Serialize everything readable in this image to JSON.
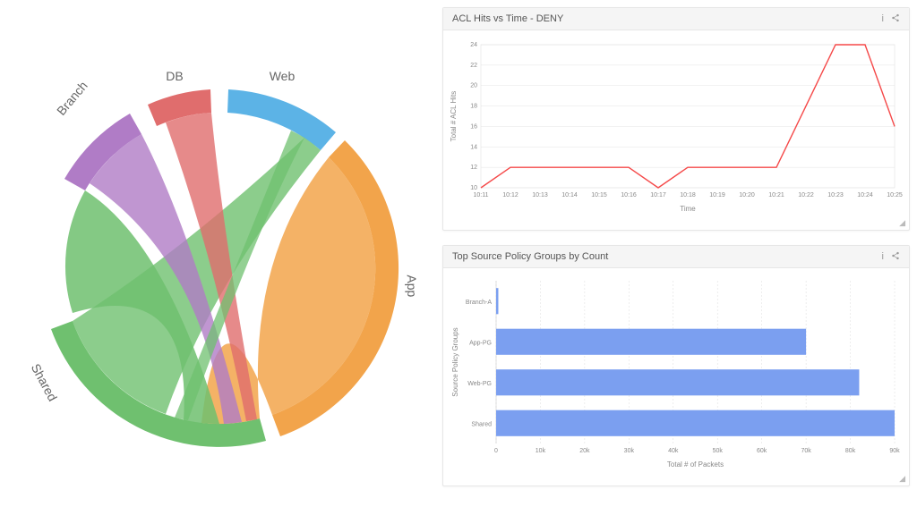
{
  "chord": {
    "labels": [
      "Branch",
      "DB",
      "Web",
      "App",
      "Shared"
    ]
  },
  "line_panel": {
    "title": "ACL Hits vs Time - DENY",
    "xlabel": "Time",
    "ylabel": "Total # ACL Hits"
  },
  "bar_panel": {
    "title": "Top Source Policy Groups by Count",
    "xlabel": "Total # of Packets",
    "ylabel": "Source Policy Groups"
  },
  "chart_data": [
    {
      "type": "chord",
      "title": "",
      "nodes": [
        "Branch",
        "DB",
        "Web",
        "App",
        "Shared"
      ],
      "links": [
        {
          "from": "App",
          "to": "Shared",
          "value": 120
        },
        {
          "from": "App",
          "to": "Web",
          "value": 40
        },
        {
          "from": "App",
          "to": "DB",
          "value": 30
        },
        {
          "from": "Branch",
          "to": "Shared",
          "value": 60
        },
        {
          "from": "Branch",
          "to": "App",
          "value": 25
        },
        {
          "from": "Web",
          "to": "Shared",
          "value": 35
        },
        {
          "from": "DB",
          "to": "Shared",
          "value": 20
        }
      ]
    },
    {
      "type": "line",
      "title": "ACL Hits vs Time - DENY",
      "xlabel": "Time",
      "ylabel": "Total # ACL Hits",
      "x": [
        "10:11",
        "10:12",
        "10:13",
        "10:14",
        "10:15",
        "10:16",
        "10:17",
        "10:18",
        "10:19",
        "10:20",
        "10:21",
        "10:22",
        "10:23",
        "10:24",
        "10:25"
      ],
      "y": [
        10,
        12,
        12,
        12,
        12,
        12,
        10,
        12,
        12,
        12,
        12,
        18,
        24,
        24,
        16
      ],
      "ylim": [
        10,
        24
      ],
      "yticks": [
        10,
        12,
        14,
        16,
        18,
        20,
        22,
        24
      ]
    },
    {
      "type": "bar",
      "orientation": "horizontal",
      "title": "Top Source Policy Groups by Count",
      "xlabel": "Total # of Packets",
      "ylabel": "Source Policy Groups",
      "categories": [
        "Branch-A",
        "App-PG",
        "Web-PG",
        "Shared"
      ],
      "values": [
        500,
        70000,
        82000,
        90000
      ],
      "xlim": [
        0,
        90000
      ],
      "xticks": [
        0,
        10000,
        20000,
        30000,
        40000,
        50000,
        60000,
        70000,
        80000,
        90000
      ],
      "xtick_labels": [
        "0",
        "10k",
        "20k",
        "30k",
        "40k",
        "50k",
        "60k",
        "70k",
        "80k",
        "90k"
      ]
    }
  ]
}
